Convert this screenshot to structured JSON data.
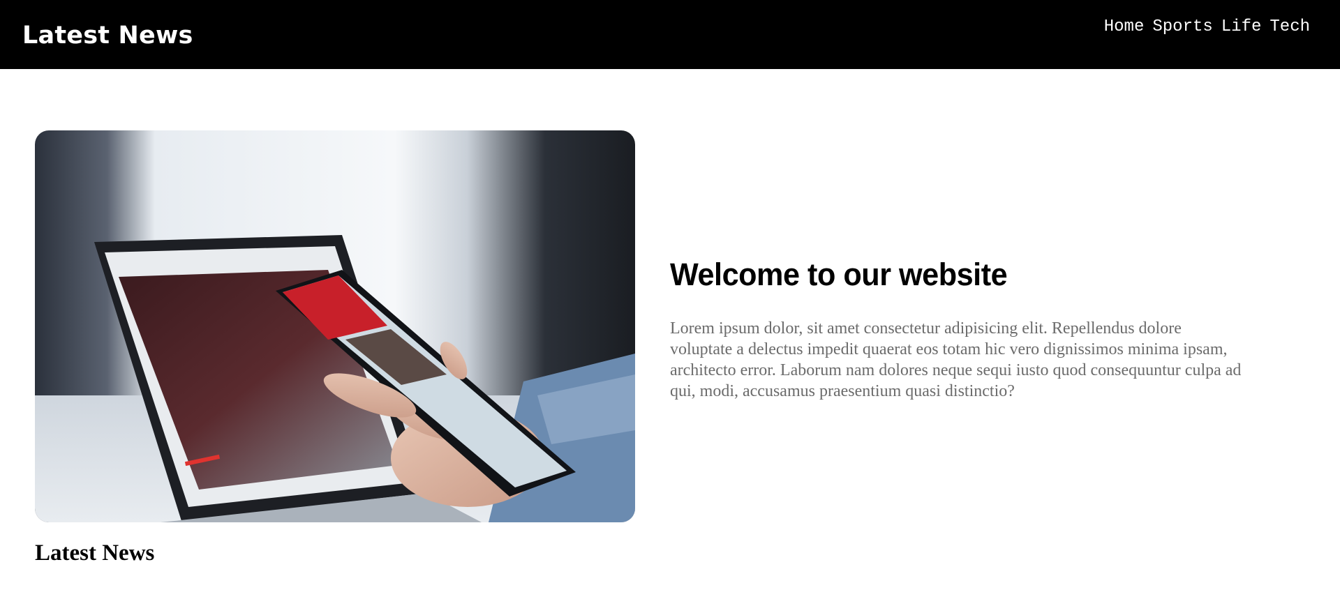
{
  "header": {
    "brand": "Latest News",
    "nav": [
      "Home",
      "Sports",
      "Life",
      "Tech"
    ]
  },
  "hero": {
    "image_subject": "hand holding smartphone showing news app in front of laptop",
    "title": "Welcome to our website",
    "body": "Lorem ipsum dolor, sit amet consectetur adipisicing elit. Repellendus dolore voluptate a delectus impedit quaerat eos totam hic vero dignissimos minima ipsam, architecto error. Laborum nam dolores neque sequi iusto quod consequuntur culpa ad qui, modi, accusamus praesentium quasi distinctio?"
  },
  "section": {
    "caption": "Latest News"
  },
  "colors": {
    "header_bg": "#000000",
    "header_text": "#ffffff",
    "body_text": "#6b6b6b",
    "news_red": "#c8202a"
  }
}
